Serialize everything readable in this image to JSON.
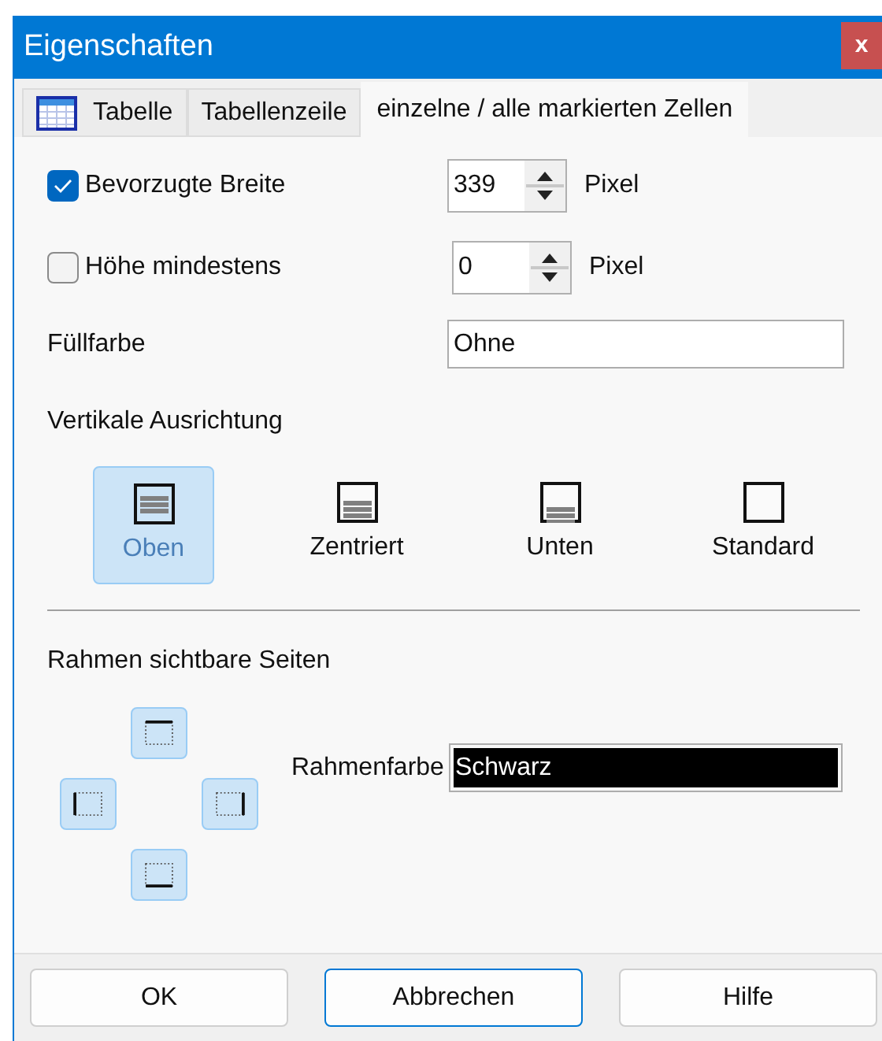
{
  "window": {
    "title": "Eigenschaften",
    "close": "x"
  },
  "tabs": [
    {
      "label": "Tabelle",
      "icon": true,
      "selected": false
    },
    {
      "label": "Tabellenzeile",
      "icon": false,
      "selected": false
    },
    {
      "label": "einzelne / alle markierten Zellen",
      "icon": false,
      "selected": true
    }
  ],
  "size_rows": [
    {
      "label": "Bevorzugte Breite",
      "checked": true,
      "value": "339",
      "unit": "Pixel"
    },
    {
      "label": "Höhe mindestens",
      "checked": false,
      "value": "0",
      "unit": "Pixel"
    }
  ],
  "fill": {
    "label": "Füllfarbe",
    "value": "Ohne"
  },
  "alignment": {
    "label": "Vertikale Ausrichtung",
    "options": [
      {
        "label": "Oben",
        "kind": "top",
        "selected": true
      },
      {
        "label": "Zentriert",
        "kind": "center",
        "selected": false
      },
      {
        "label": "Unten",
        "kind": "bottom",
        "selected": false
      },
      {
        "label": "Standard",
        "kind": "none",
        "selected": false
      }
    ]
  },
  "border": {
    "label": "Rahmen sichtbare Seiten",
    "sides": [
      {
        "kind": "top",
        "selected": true
      },
      {
        "kind": "left",
        "selected": true
      },
      {
        "kind": "right",
        "selected": true
      },
      {
        "kind": "bottom",
        "selected": true
      }
    ],
    "color_label": "Rahmenfarbe",
    "color_value": "Schwarz",
    "color": "#000000"
  },
  "buttons": [
    {
      "label": "OK",
      "default": false
    },
    {
      "label": "Abbrechen",
      "default": true
    },
    {
      "label": "Hilfe",
      "default": false
    }
  ]
}
